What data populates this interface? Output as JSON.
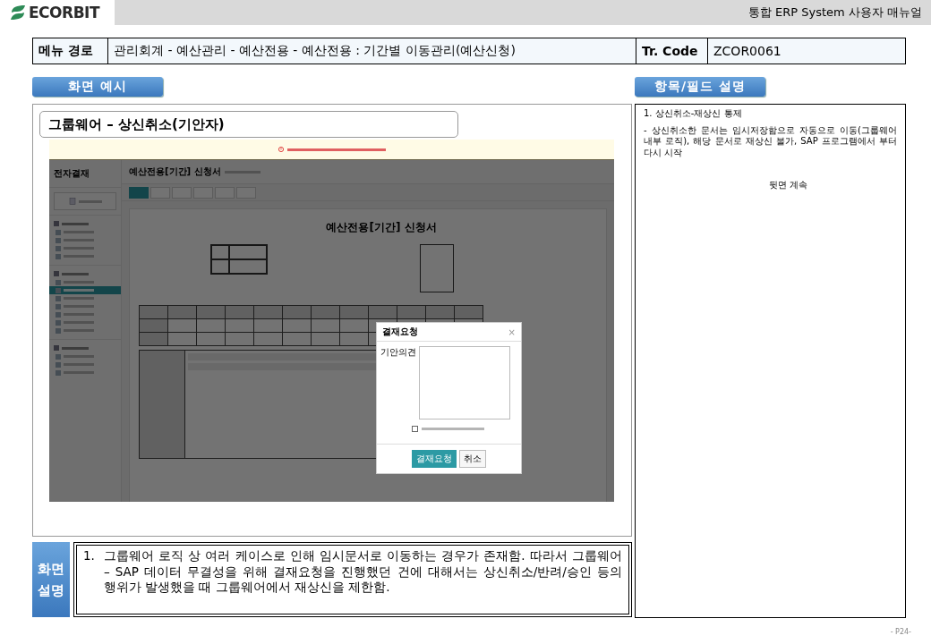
{
  "header": {
    "logo": "ECORBIT",
    "title": "통합 ERP System 사용자 매뉴얼"
  },
  "menu_path": {
    "label": "메뉴 경로",
    "path": "관리회계 - 예산관리 - 예산전용 - 예산전용 : 기간별 이동관리(예산신청)",
    "code_label": "Tr. Code",
    "code": "ZCOR0061"
  },
  "screen_example": {
    "heading": "화면 예시",
    "caption": "그룹웨어 – 상신취소(기안자)",
    "screenshot": {
      "app_title": "전자결재",
      "nav_groups": [
        {
          "items": [
            {
              "selected": false
            },
            {
              "selected": false
            },
            {
              "selected": false
            },
            {
              "selected": false
            }
          ]
        },
        {
          "items": [
            {
              "selected": false
            },
            {
              "selected": true
            },
            {
              "selected": false
            },
            {
              "selected": false
            },
            {
              "selected": false
            },
            {
              "selected": false
            },
            {
              "selected": false
            }
          ]
        },
        {
          "items": [
            {
              "selected": false
            },
            {
              "selected": false
            },
            {
              "selected": false
            }
          ]
        }
      ],
      "page_title": "예산전용[기간] 신청서",
      "toolbar": [
        {
          "selected": true
        },
        {
          "selected": false
        },
        {
          "selected": false
        },
        {
          "selected": false
        },
        {
          "selected": false
        },
        {
          "selected": false
        }
      ],
      "doc_title": "예산전용[기간] 신청서",
      "dialog": {
        "title": "결재요청",
        "close": "×",
        "field_label": "기안의견",
        "checkbox": {
          "checked": false
        },
        "buttons": [
          "결재요청",
          "취소"
        ]
      }
    }
  },
  "description": {
    "label": "화면 설명",
    "number": "1.",
    "text": "그룹웨어 로직 상 여러 케이스로 인해 임시문서로 이동하는 경우가 존재함. 따라서 그룹웨어 – SAP 데이터 무결성을 위해 결재요청을 진행했던 건에 대해서는 상신취소/반려/승인 등의 행위가 발생했을 때 그룹웨어에서 재상신을 제한함."
  },
  "field_notes": {
    "heading": "항목/필드 설명",
    "title": "1. 상신취소-재상신 통제",
    "body": " - 상신취소한 문서는 임시저장함으로 자동으로 이동(그룹웨어 내부 로직), 해당 문서로 재상신 불가, SAP 프로그램에서 부터 다시 시작",
    "footer": "뒷면 계속"
  },
  "page_number": "- P24-"
}
